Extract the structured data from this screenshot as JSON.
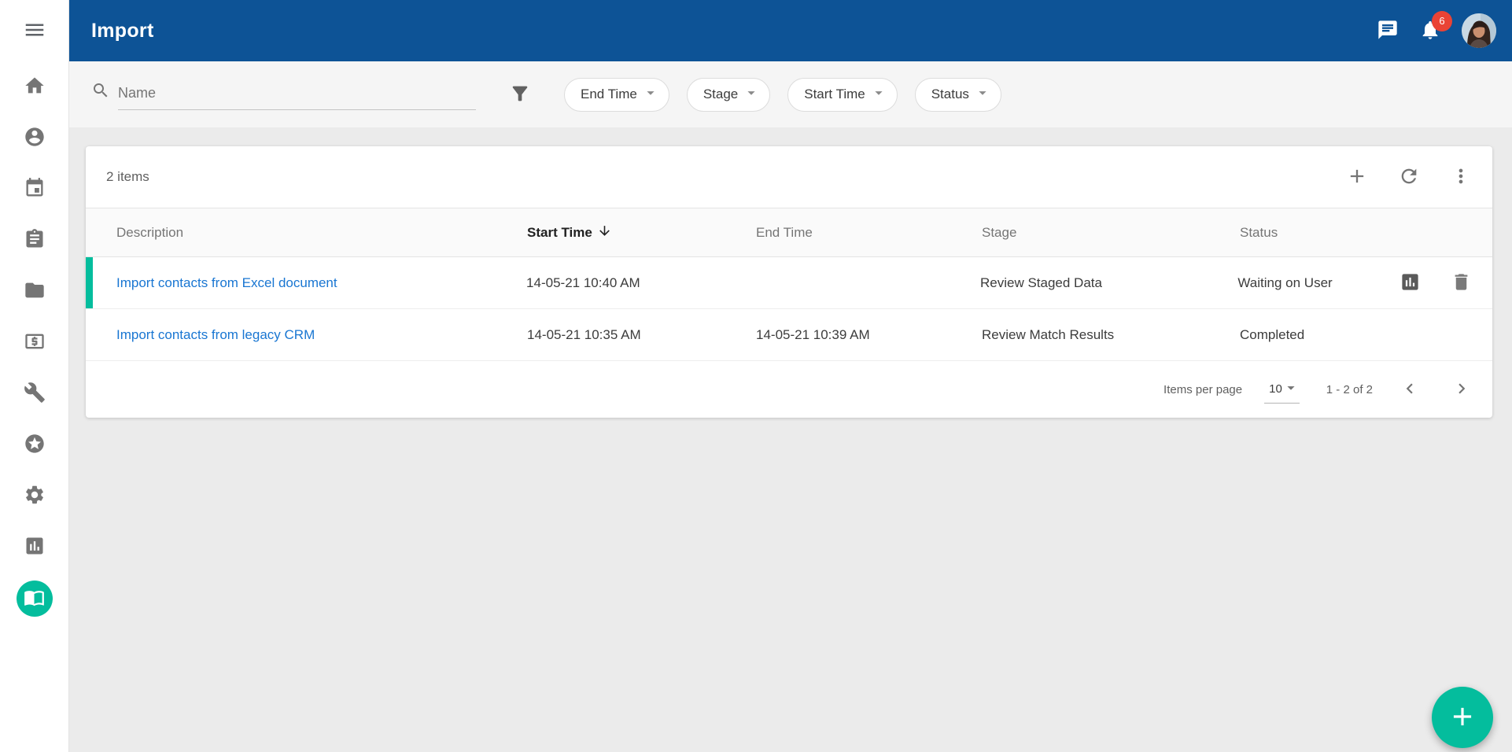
{
  "app": {
    "title": "Import"
  },
  "header": {
    "badge_count": "6"
  },
  "sidebar": {
    "items": [
      {
        "icon": "home-icon"
      },
      {
        "icon": "person-icon"
      },
      {
        "icon": "calendar-icon"
      },
      {
        "icon": "clipboard-icon"
      },
      {
        "icon": "folder-icon"
      },
      {
        "icon": "money-icon"
      },
      {
        "icon": "wrench-icon"
      },
      {
        "icon": "star-icon"
      },
      {
        "icon": "settings-icon"
      },
      {
        "icon": "bar-chart-icon"
      },
      {
        "icon": "import-contacts-icon",
        "active": true
      }
    ]
  },
  "filters": {
    "search": {
      "placeholder": "Name"
    },
    "chips": [
      {
        "label": "End Time"
      },
      {
        "label": "Stage"
      },
      {
        "label": "Start Time"
      },
      {
        "label": "Status"
      }
    ]
  },
  "list": {
    "count_label": "2 items",
    "columns": {
      "description": "Description",
      "start_time": "Start Time",
      "end_time": "End Time",
      "stage": "Stage",
      "status": "Status"
    },
    "sort": {
      "column": "start_time",
      "direction": "desc"
    },
    "rows": [
      {
        "description": "Import contacts from Excel document",
        "start_time": "14-05-21 10:40 AM",
        "end_time": "",
        "stage": "Review Staged Data",
        "status": "Waiting on User",
        "highlighted": true
      },
      {
        "description": "Import contacts from legacy CRM",
        "start_time": "14-05-21 10:35 AM",
        "end_time": "14-05-21 10:39 AM",
        "stage": "Review Match Results",
        "status": "Completed",
        "highlighted": false
      }
    ],
    "pagination": {
      "items_per_page_label": "Items per page",
      "page_size": "10",
      "range_label": "1 - 2 of 2"
    }
  },
  "colors": {
    "header": "#0d5396",
    "accent": "#04bd9d",
    "link": "#1976d2",
    "badge": "#ea4335"
  }
}
